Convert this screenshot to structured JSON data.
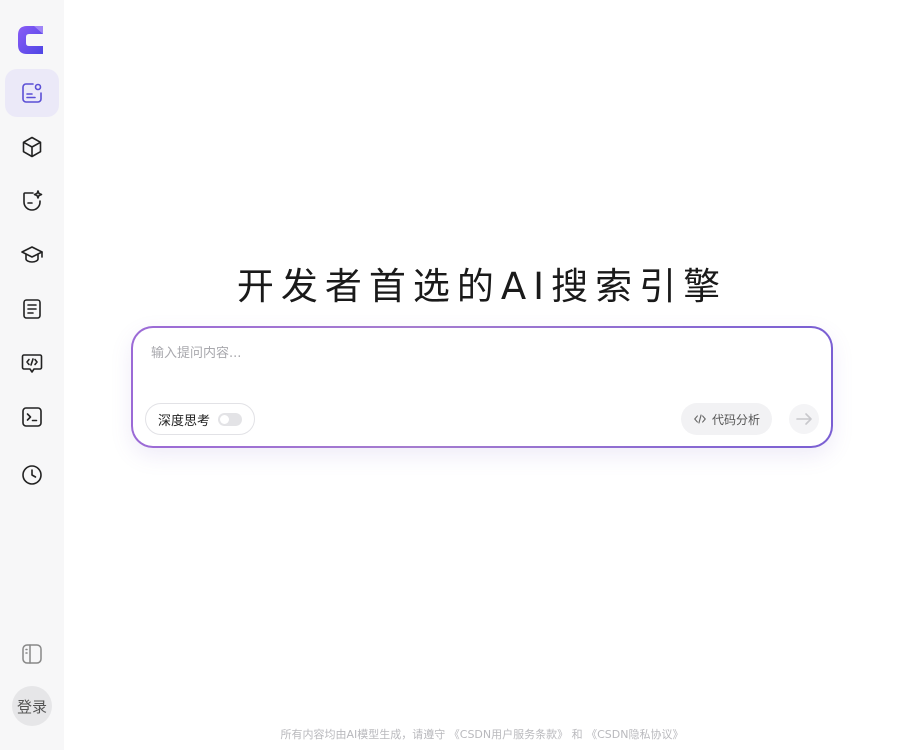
{
  "brand": {
    "logo_icon": "csdn-c-logo-icon",
    "accent_start": "#6a5cf5",
    "accent_end": "#9b6ad6"
  },
  "sidebar": {
    "items": [
      {
        "name": "chat",
        "icon": "chat-note-icon",
        "active": true
      },
      {
        "name": "models",
        "icon": "cube-icon",
        "active": false
      },
      {
        "name": "agent",
        "icon": "shield-sparkle-icon",
        "active": false
      },
      {
        "name": "learn",
        "icon": "graduation-cap-icon",
        "active": false
      },
      {
        "name": "docs",
        "icon": "document-icon",
        "active": false
      },
      {
        "name": "code-chat",
        "icon": "code-bubble-icon",
        "active": false
      },
      {
        "name": "terminal",
        "icon": "terminal-icon",
        "active": false
      },
      {
        "name": "history",
        "icon": "clock-icon",
        "active": false
      }
    ],
    "collapse_icon": "sidebar-toggle-icon",
    "login_label": "登录"
  },
  "main": {
    "headline": "开发者首选的AI搜索引擎",
    "input": {
      "placeholder": "输入提问内容...",
      "value": ""
    },
    "deep_think_label": "深度思考",
    "deep_think_enabled": false,
    "code_analysis_label": "代码分析",
    "send_icon": "arrow-right-icon"
  },
  "footer": {
    "disclaimer": "所有内容均由AI模型生成，请遵守 《CSDN用户服务条款》 和 《CSDN隐私协议》"
  }
}
